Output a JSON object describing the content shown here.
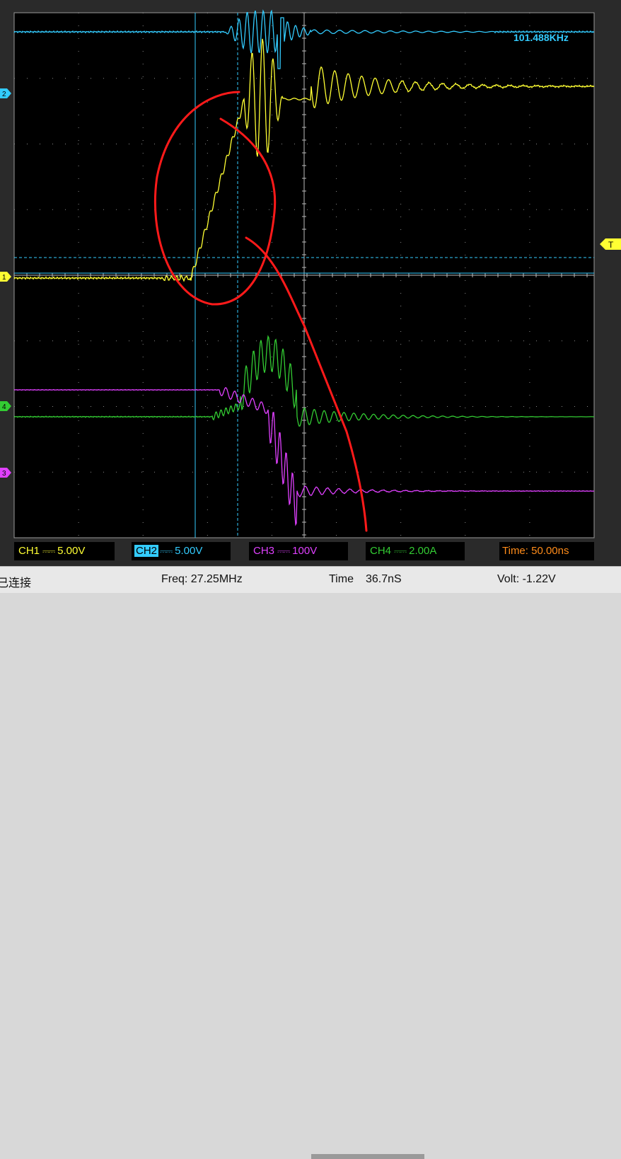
{
  "scope": {
    "background": "#000000",
    "grid_color": "#8a8a8a",
    "cursor_color": "#33ccff",
    "freq_readout": "101.488KHz",
    "markers": {
      "ch1": "1",
      "ch2": "2",
      "ch3": "3",
      "ch4": "4",
      "trigger": "T"
    },
    "colors": {
      "ch1": "#ffff33",
      "ch2": "#33ccff",
      "ch3": "#e040ff",
      "ch4": "#33cc33",
      "annotation": "#ff1a1a"
    }
  },
  "channels": [
    {
      "name": "CH1",
      "coupling": "⎓⎓",
      "scale": "5.00V"
    },
    {
      "name": "CH2",
      "coupling": "⎓⎓",
      "scale": "5.00V"
    },
    {
      "name": "CH3",
      "coupling": "⎓⎓",
      "scale": "100V"
    },
    {
      "name": "CH4",
      "coupling": "⎓⎓",
      "scale": "2.00A"
    }
  ],
  "timebase": "Time: 50.00ns",
  "statusbar": {
    "connection": "已连接",
    "freq": "Freq: 27.25MHz",
    "time_label": "Time",
    "time_value": "36.7nS",
    "volt": "Volt: -1.22V"
  }
}
